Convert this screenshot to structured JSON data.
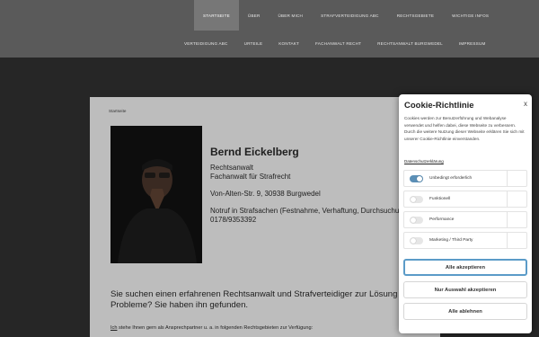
{
  "nav": {
    "row1": [
      "Startseite",
      "Über",
      "Über mich",
      "Strafverteidigung ABC",
      "Rechtsgebiete",
      "Wichtige Infos"
    ],
    "row2": [
      "Verteidigung ABC",
      "Urteile",
      "Kontakt",
      "Fachanwalt Recht",
      "Rechtsanwalt Burgwedel",
      "Impressum"
    ],
    "active_index": 0
  },
  "page": {
    "breadcrumb": "Startseite",
    "name": "Bernd Eickelberg",
    "title1": "Rechtsanwalt",
    "title2": "Fachanwalt für Strafrecht",
    "address": "Von-Alten-Str. 9, 30938 Burgwedel",
    "notruf": "Notruf in Strafsachen (Festnahme, Verhaftung, Durchsuchung):",
    "phone": "0178/9353392",
    "lead1": "Sie suchen einen erfahrenen Rechtsanwalt und Strafverteidiger zur Lösung Ihrer",
    "lead2": "Probleme? Sie haben ihn gefunden.",
    "small_link": "Ich",
    "small_rest": " stehe Ihnen gern als Ansprechpartner u. a. in folgenden Rechtsgebieten zur Verfügung:"
  },
  "cookie": {
    "title": "Cookie-Richtlinie",
    "close": "x",
    "text": "Cookies werden zur Benutzerführung und Webanalyse verwendet und helfen dabei, diese Webseite zu verbessern. Durch die weitere Nutzung dieser Webseite erklären Sie sich mit unserer Cookie-Richtlinie einverstanden.",
    "privacy_link": "Datenschutzerklärung",
    "options": [
      {
        "label": "Unbedingt erforderlich",
        "on": true
      },
      {
        "label": "Funktionell",
        "on": false
      },
      {
        "label": "Performance",
        "on": false
      },
      {
        "label": "Marketing / Third Party",
        "on": false
      }
    ],
    "accept_all": "Alle akzeptieren",
    "accept_selection": "Nur Auswahl akzeptieren",
    "reject_all": "Alle ablehnen"
  },
  "colors": {
    "header": "#5a5a5a",
    "card": "#bdbdbd",
    "accent": "#5b9bc8"
  }
}
